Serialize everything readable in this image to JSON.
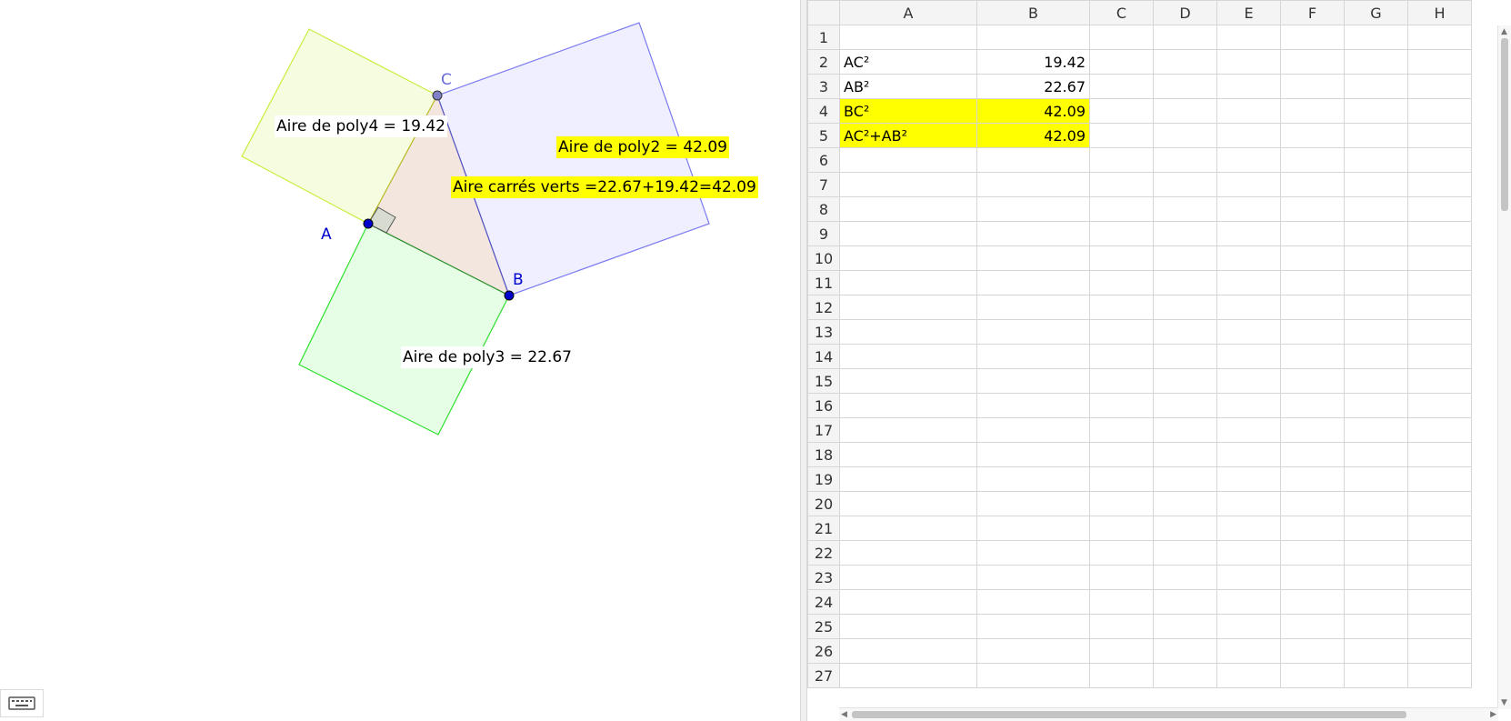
{
  "graphics": {
    "labels": {
      "poly4": "Aire de poly4 = 19.42",
      "poly2": "Aire de poly2 = 42.09",
      "sum": "Aire carrés verts =22.67+19.42=42.09",
      "poly3": "Aire de poly3 = 22.67"
    },
    "points": {
      "A": "A",
      "B": "B",
      "C": "C"
    },
    "colors": {
      "square_bc": "#7b7bf0",
      "square_ac": "#c6ef3a",
      "square_ab": "#2ee02e",
      "triangle": "#f3e6df",
      "point": "#0000cc",
      "highlight": "#ffff00"
    }
  },
  "keyboard_button": {
    "icon": "keyboard-icon"
  },
  "spreadsheet": {
    "columns": [
      "A",
      "B",
      "C",
      "D",
      "E",
      "F",
      "G",
      "H"
    ],
    "rows": [
      "1",
      "2",
      "3",
      "4",
      "5",
      "6",
      "7",
      "8",
      "9",
      "10",
      "11",
      "12",
      "13",
      "14",
      "15",
      "16",
      "17",
      "18",
      "19",
      "20",
      "21",
      "22",
      "23",
      "24",
      "25",
      "26",
      "27"
    ],
    "cells": {
      "A2": "AC²",
      "B2": "19.42",
      "A3": "AB²",
      "B3": "22.67",
      "A4": "BC²",
      "B4": "42.09",
      "A5": "AC²+AB²",
      "B5": "42.09"
    },
    "highlighted_rows": [
      "4",
      "5"
    ],
    "highlight_color": "#ffff00"
  }
}
